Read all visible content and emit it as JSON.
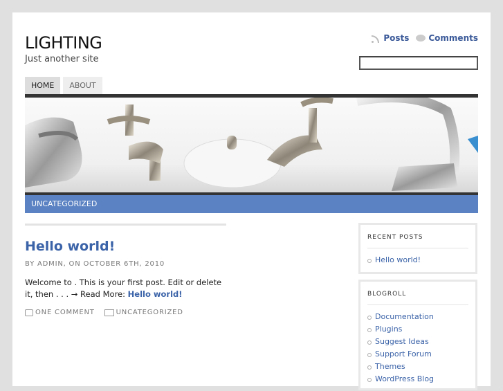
{
  "site": {
    "title": "LIGHTING",
    "description": "Just another site"
  },
  "feeds": {
    "posts": "Posts",
    "comments": "Comments"
  },
  "search": {
    "value": ""
  },
  "nav": [
    {
      "label": "HOME",
      "active": true
    },
    {
      "label": "ABOUT",
      "active": false
    }
  ],
  "category_bar": {
    "label": "UNCATEGORIZED"
  },
  "post": {
    "title": "Hello world!",
    "meta": "BY ADMIN, ON OCTOBER 6TH, 2010",
    "body": "Welcome to . This is your first post. Edit or delete it, then . . . → Read More:",
    "read_more_link": "Hello world!",
    "comments": "ONE COMMENT",
    "category": "UNCATEGORIZED"
  },
  "sidebar": {
    "recent": {
      "title": "RECENT POSTS",
      "items": [
        "Hello world!"
      ]
    },
    "blogroll": {
      "title": "BLOGROLL",
      "items": [
        "Documentation",
        "Plugins",
        "Suggest Ideas",
        "Support Forum",
        "Themes",
        "WordPress Blog"
      ]
    }
  },
  "colors": {
    "accent": "#5b82c2",
    "link": "#3b63a8",
    "bar": "#333333"
  }
}
